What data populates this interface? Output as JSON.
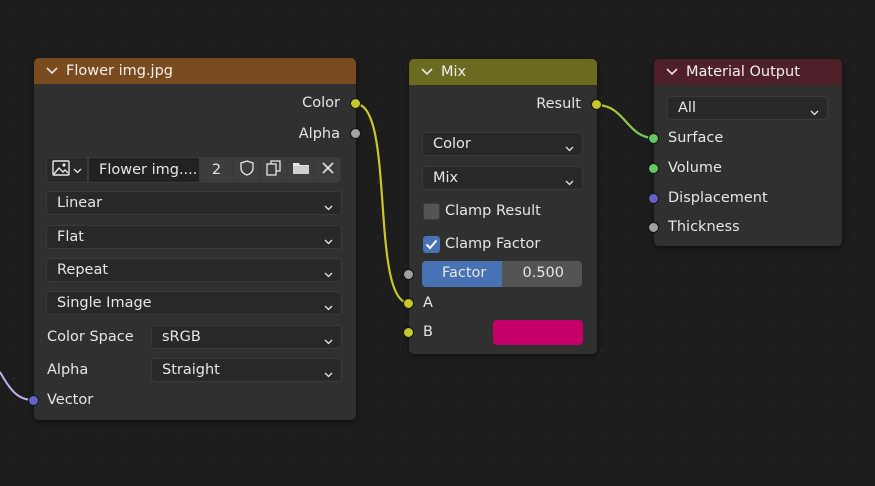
{
  "image_node": {
    "title": "Flower img.jpg",
    "header_color": "#7a4b1f",
    "outputs": {
      "color": "Color",
      "alpha": "Alpha"
    },
    "image_name": "Flower img....",
    "user_count": "2",
    "interpolation": "Linear",
    "projection": "Flat",
    "extension": "Repeat",
    "source": "Single Image",
    "color_space_label": "Color Space",
    "color_space": "sRGB",
    "alpha_label": "Alpha",
    "alpha_mode": "Straight",
    "input_vector": "Vector"
  },
  "mix_node": {
    "title": "Mix",
    "header_color": "#6b6b20",
    "output_result": "Result",
    "data_type": "Color",
    "blend_mode": "Mix",
    "clamp_result_label": "Clamp Result",
    "clamp_result": false,
    "clamp_factor_label": "Clamp Factor",
    "clamp_factor": true,
    "factor_label": "Factor",
    "factor_value": "0.500",
    "factor_fraction": 0.5,
    "input_a": "A",
    "input_b": "B",
    "b_color": "#c6006b"
  },
  "output_node": {
    "title": "Material Output",
    "header_color": "#4f1f2a",
    "target": "All",
    "inputs": [
      "Surface",
      "Volume",
      "Displacement",
      "Thickness"
    ]
  },
  "colors": {
    "link_yellow": "#c7c729",
    "link_vector": "#bdb3e6",
    "accent_blue": "#4772b3"
  },
  "icons": [
    "image-icon",
    "chevron-down-icon",
    "fake-user-shield-icon",
    "duplicate-icon",
    "folder-icon",
    "close-icon",
    "checkmark-icon"
  ]
}
